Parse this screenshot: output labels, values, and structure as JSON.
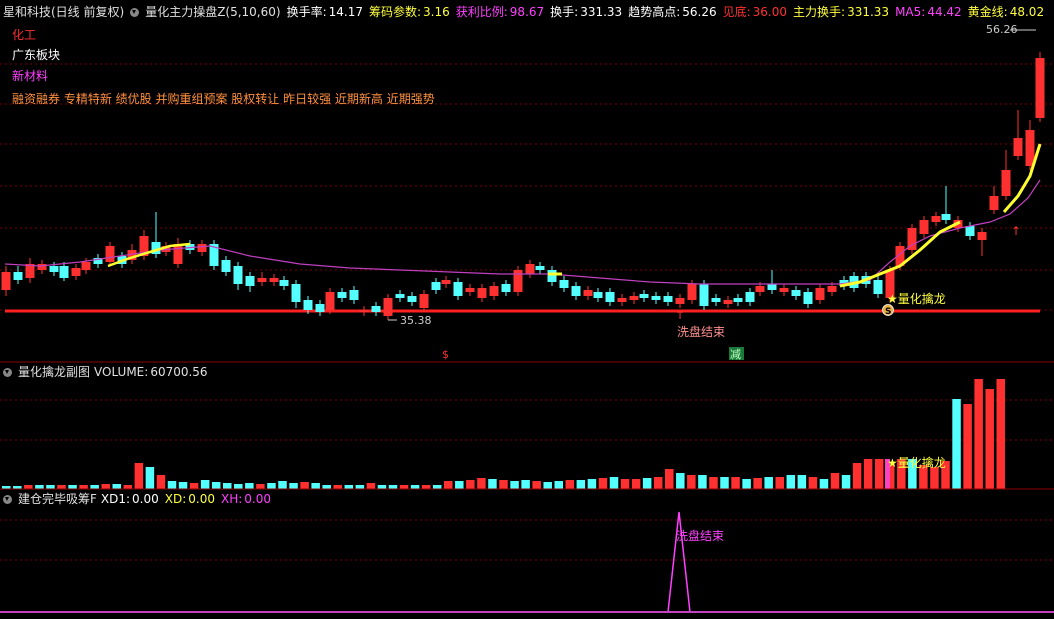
{
  "header": {
    "stock": "星和科技(日线 前复权)",
    "indicator": "量化主力操盘Z(5,10,60)",
    "items": [
      {
        "label": "换手率:",
        "value": "14.17",
        "color": "#ffffff"
      },
      {
        "label": "筹码参数:",
        "value": "3.16",
        "color": "#ffff40"
      },
      {
        "label": "获利比例:",
        "value": "98.67",
        "color": "#ff40ff"
      },
      {
        "label": "换手:",
        "value": "331.33",
        "color": "#ffffff"
      },
      {
        "label": "趋势高点:",
        "value": "56.26",
        "color": "#ffffff"
      },
      {
        "label": "见底:",
        "value": "36.00",
        "color": "#ff3030"
      },
      {
        "label": "主力换手:",
        "value": "331.33",
        "color": "#ffff40"
      },
      {
        "label": "MA5:",
        "value": "44.42",
        "color": "#ff40ff"
      },
      {
        "label": "黄金线:",
        "value": "48.02",
        "color": "#ffff40"
      }
    ]
  },
  "tags": {
    "industry": "化工",
    "region": "广东板块",
    "concept": "新材料",
    "features": "融资融券 专精特新 绩优股 并购重组预案 股权转让 昨日较强 近期新高 近期强势"
  },
  "price_panel": {
    "high_label": "56.26",
    "low_label": "35.38",
    "wash_label": "洗盘结束",
    "dragon_label": "★量化擒龙",
    "s_marker": "S",
    "dollar_marker": "$",
    "reduce_marker": "减",
    "up_arrow": "↑"
  },
  "sub_panel": {
    "title": "量化擒龙副图",
    "volume_label": "VOLUME:",
    "volume_value": "60700.56",
    "dragon_label": "★量化擒龙"
  },
  "third_panel": {
    "title": "建仓完毕吸筹F",
    "items": [
      {
        "label": "XD1:",
        "value": "0.00",
        "color": "#ffffff"
      },
      {
        "label": "XD:",
        "value": "0.00",
        "color": "#ffff40"
      },
      {
        "label": "XH:",
        "value": "0.00",
        "color": "#ff40ff"
      }
    ],
    "wash_label": "洗盘结束"
  },
  "colors": {
    "up": "#ff3030",
    "down": "#54ffff",
    "ma": "#c040c0",
    "gold": "#ffff30",
    "grid": "#7a0000",
    "support": "#ff2020"
  }
}
